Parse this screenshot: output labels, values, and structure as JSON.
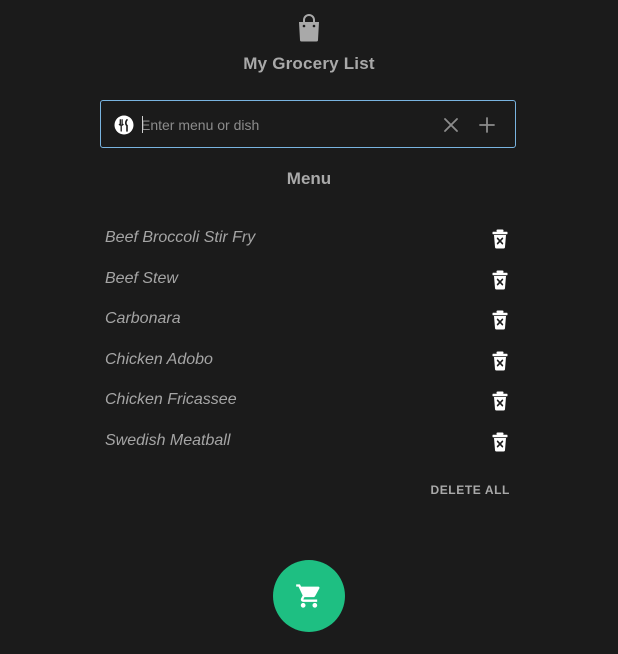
{
  "app": {
    "title": "My Grocery List"
  },
  "icons": {
    "header": "shopping-bag-icon",
    "input": "dish-icon",
    "clear": "close-icon",
    "add": "plus-icon",
    "item_delete": "delete-icon",
    "fab": "shopping-cart-icon"
  },
  "search": {
    "placeholder": "Enter menu or dish",
    "value": ""
  },
  "menu": {
    "heading": "Menu",
    "items": [
      {
        "label": "Beef Broccoli Stir Fry"
      },
      {
        "label": "Beef Stew"
      },
      {
        "label": "Carbonara"
      },
      {
        "label": "Chicken Adobo"
      },
      {
        "label": "Chicken Fricassee"
      },
      {
        "label": "Swedish Meatball"
      }
    ],
    "delete_all_label": "DELETE ALL"
  },
  "colors": {
    "background": "#1b1b1b",
    "text": "#a9a9a9",
    "input_border": "#79b4e0",
    "fab": "#1ebf82",
    "icon": "#ffffff"
  }
}
